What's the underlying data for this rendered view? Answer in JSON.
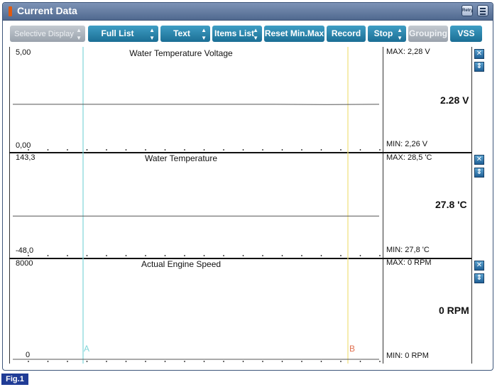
{
  "window": {
    "title": "Current Data",
    "retry_label": "Retry"
  },
  "toolbar": {
    "selective_display": "Selective Display",
    "full_list": "Full List",
    "text": "Text",
    "items_list": "Items List",
    "reset_min_max": "Reset Min.Max",
    "record": "Record",
    "stop": "Stop",
    "grouping": "Grouping",
    "vss": "VSS"
  },
  "cursors": {
    "a_label": "A",
    "b_label": "B"
  },
  "icons": {
    "close": "close-icon",
    "expand": "expand-icon",
    "retry": "retry-icon",
    "menu": "menu-icon",
    "title_marker": "status-marker-icon"
  },
  "colors": {
    "accent": "#1b6e95",
    "cursor_a": "#7fd6d9",
    "cursor_b": "#f0e07a",
    "caption_bg": "#203c96"
  },
  "panels": [
    {
      "title": "Water Temperature Voltage",
      "y_max": "5,00",
      "y_min": "0,00",
      "max_text": "MAX:  2,28 V",
      "min_text": "MIN:  2,26 V",
      "value": "2.28 V"
    },
    {
      "title": "Water Temperature",
      "y_max": "143,3",
      "y_min": "-48,0",
      "max_text": "MAX:  28,5 'C",
      "min_text": "MIN:  27,8 'C",
      "value": "27.8 'C"
    },
    {
      "title": "Actual Engine Speed",
      "y_max": "8000",
      "y_min": "0",
      "max_text": "MAX:      0 RPM",
      "min_text": "MIN:      0 RPM",
      "value": "0 RPM"
    }
  ],
  "chart_data": [
    {
      "type": "line",
      "title": "Water Temperature Voltage",
      "ylim": [
        0.0,
        5.0
      ],
      "series": [
        {
          "values": [
            2.28,
            2.28,
            2.28,
            2.28,
            2.28,
            2.28,
            2.27,
            2.28
          ]
        }
      ]
    },
    {
      "type": "line",
      "title": "Water Temperature",
      "ylim": [
        -48.0,
        143.3
      ],
      "series": [
        {
          "values": [
            27.8,
            27.8,
            27.8,
            27.8,
            27.8,
            27.8,
            27.8,
            27.8
          ]
        }
      ]
    },
    {
      "type": "line",
      "title": "Actual Engine Speed",
      "ylim": [
        0,
        8000
      ],
      "series": [
        {
          "values": [
            0,
            0,
            0,
            0,
            0,
            0,
            0,
            0
          ]
        }
      ]
    }
  ],
  "caption": "Fig.1"
}
